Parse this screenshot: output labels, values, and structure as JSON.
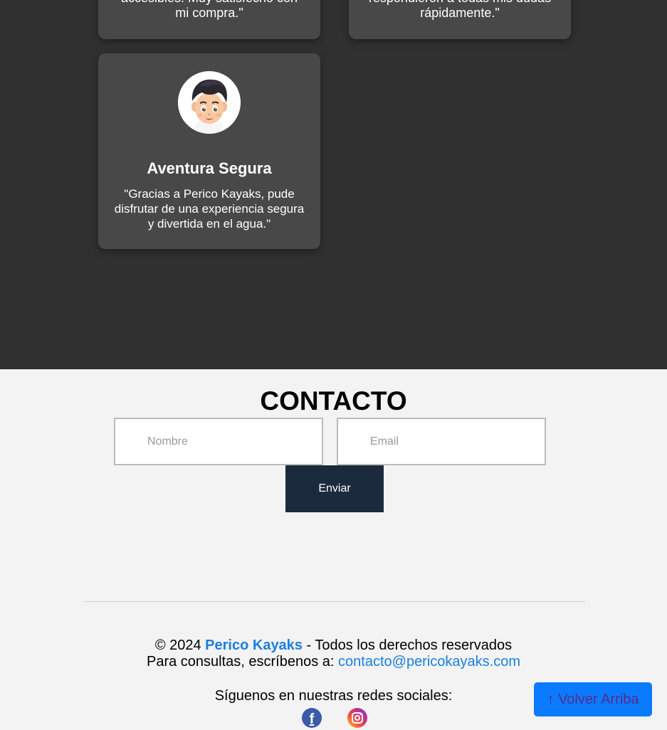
{
  "testimonials": {
    "cards_top": [
      {
        "text": "accesibles. Muy satisfecho con mi compra.\""
      },
      {
        "text": "respondieron a todas mis dudas rápidamente.\""
      }
    ],
    "main_card": {
      "title": "Aventura Segura",
      "text": "\"Gracias a Perico Kayaks, pude disfrutar de una experiencia segura y divertida en el agua.\"",
      "avatar_icon": "cartoon-boy-avatar"
    }
  },
  "contact": {
    "title": "CONTACTO",
    "name_placeholder": "Nombre",
    "email_placeholder": "Email",
    "submit_label": "Enviar"
  },
  "footer": {
    "copyright_prefix": "© 2024",
    "brand": "Perico Kayaks",
    "rights_suffix": "- Todos los derechos reservados",
    "contact_prefix": "Para consultas, escríbenos a:",
    "contact_email": "contacto@pericokayaks.com",
    "social_heading": "Síguenos en nuestras redes sociales:",
    "social_icons": [
      "facebook-icon",
      "instagram-icon"
    ]
  },
  "back_to_top": {
    "label": "↑ Volver Arriba"
  },
  "colors": {
    "dark_bg": "#303030",
    "card_bg": "#484848",
    "accent": "#1a7fe0",
    "button_dark": "#1c2a3d",
    "back_to_top_bg": "#0a7bff"
  }
}
